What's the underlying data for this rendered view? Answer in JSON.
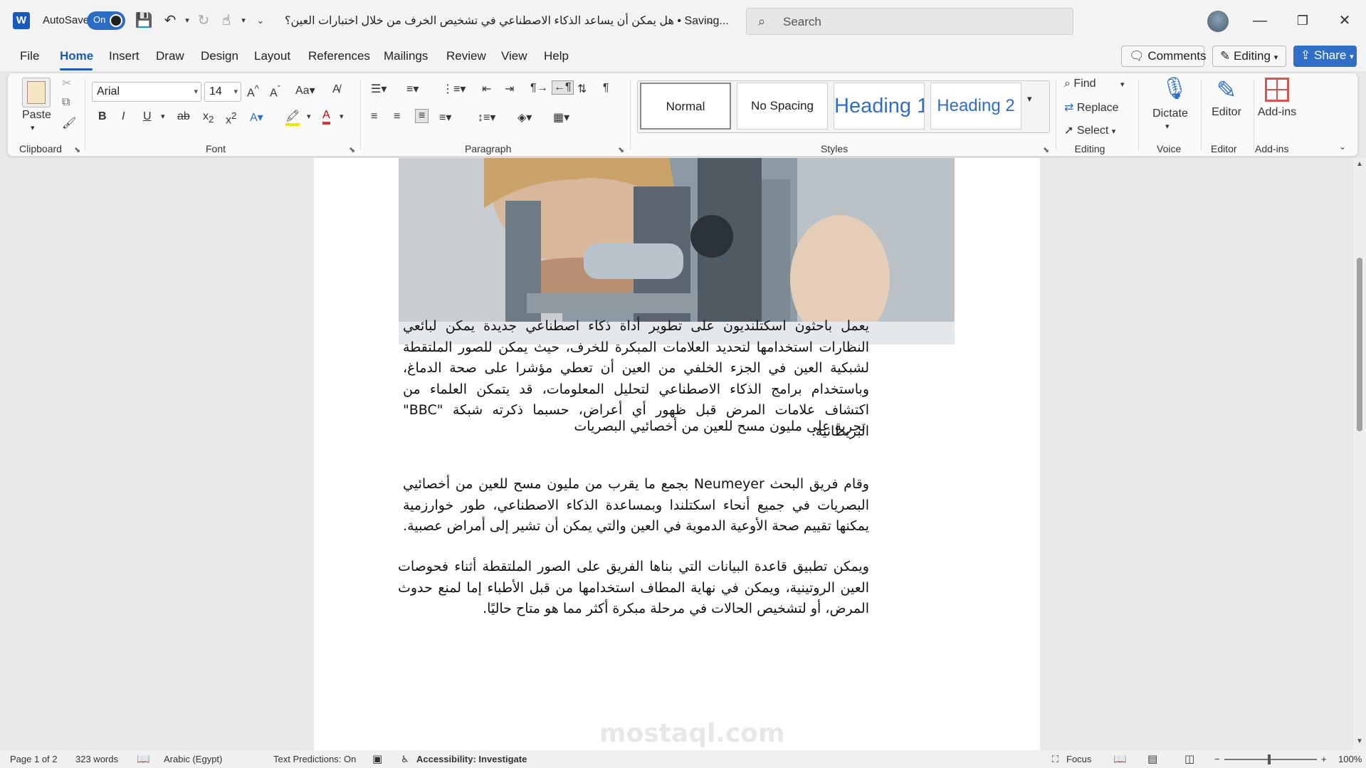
{
  "titlebar": {
    "app_logo": "W",
    "autosave_label": "AutoSave",
    "autosave_state": "On",
    "document_title": "هل يمكن أن يساعد الذكاء الاصطناعي في تشخيص الخرف من خلال اختبارات العين؟ • Saving...",
    "search_placeholder": "Search"
  },
  "menu": {
    "tabs": [
      "File",
      "Home",
      "Insert",
      "Draw",
      "Design",
      "Layout",
      "References",
      "Mailings",
      "Review",
      "View",
      "Help"
    ],
    "active_tab": "Home",
    "comments_label": "Comments",
    "editing_label": "Editing",
    "share_label": "Share"
  },
  "ribbon": {
    "clipboard": {
      "paste_label": "Paste",
      "group_label": "Clipboard"
    },
    "font": {
      "font_name": "Arial",
      "font_size": "14",
      "group_label": "Font"
    },
    "paragraph": {
      "group_label": "Paragraph"
    },
    "styles": {
      "group_label": "Styles",
      "items": [
        "Normal",
        "No Spacing",
        "Heading 1",
        "Heading 2"
      ]
    },
    "editing": {
      "find_label": "Find",
      "replace_label": "Replace",
      "select_label": "Select",
      "group_label": "Editing"
    },
    "voice": {
      "dictate_label": "Dictate",
      "group_label": "Voice"
    },
    "editor": {
      "editor_label": "Editor",
      "group_label": "Editor"
    },
    "addins": {
      "addins_label": "Add-ins",
      "group_label": "Add-ins"
    }
  },
  "document": {
    "paragraphs": [
      "يعمل باحثون اسكتلنديون على تطوير أداة ذكاء اصطناعي جديدة يمكن لبائعي النظارات استخدامها لتحديد العلامات المبكرة للخرف، حيث يمكن للصور الملتقطة لشبكية العين في الجزء الخلفي من العين أن تعطي مؤشرا على صحة الدماغ، وباستخدام برامج الذكاء الاصطناعي لتحليل المعلومات، قد يتمكن العلماء من اكتشاف علامات المرض قبل ظهور أي أعراض، حسبما ذكرته شبكة \"BBC\" البريطانية.",
      "تجربة على مليون مسح للعين من أخصائيي البصريات",
      "وقام فريق البحث Neumeyer بجمع ما يقرب من مليون مسح للعين من أخصائيي البصريات في جميع أنحاء اسكتلندا وبمساعدة الذكاء الاصطناعي، طور خوارزمية يمكنها تقييم صحة الأوعية الدموية في العين والتي يمكن أن تشير إلى أمراض عصبية.",
      "ويمكن تطبيق قاعدة البيانات التي بناها الفريق على الصور الملتقطة أثناء فحوصات العين الروتينية، ويمكن في نهاية المطاف استخدامها من قبل الأطباء إما لمنع حدوث المرض، أو لتشخيص الحالات في مرحلة مبكرة أكثر مما هو متاح حاليًا."
    ],
    "watermark": "mostaql.com"
  },
  "status": {
    "page": "Page 1 of 2",
    "words": "323 words",
    "language": "Arabic (Egypt)",
    "text_predictions": "Text Predictions: On",
    "accessibility": "Accessibility: Investigate",
    "focus": "Focus",
    "zoom": "100%"
  },
  "colors": {
    "accent": "#185abd",
    "share_button": "#2f6fc7",
    "heading_style": "#2f6fc7"
  }
}
